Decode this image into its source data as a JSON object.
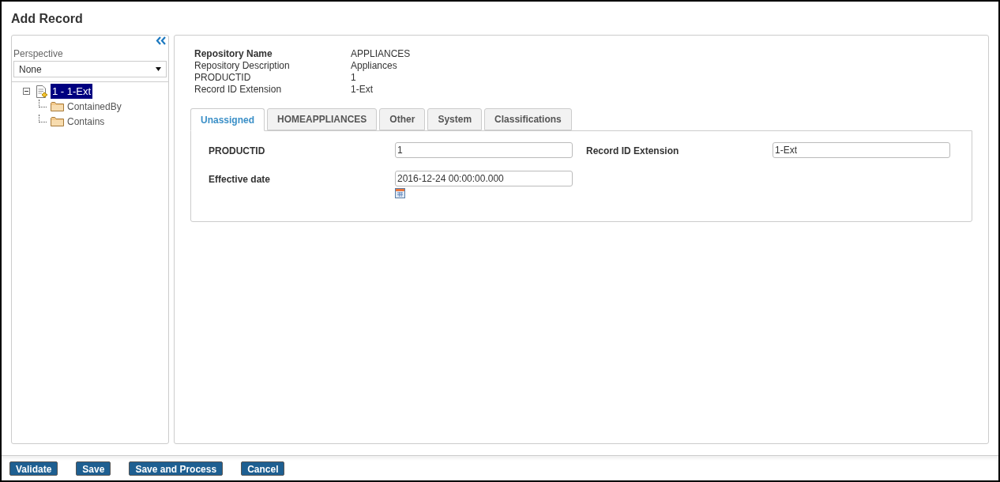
{
  "window": {
    "title": "Add Record"
  },
  "sidebar": {
    "perspective": {
      "label": "Perspective",
      "value": "None"
    },
    "tree": [
      {
        "label": "1 - 1-Ext",
        "selected": true,
        "expanded": true,
        "children": [
          {
            "label": "ContainedBy",
            "selected": false
          },
          {
            "label": "Contains",
            "selected": false
          }
        ]
      }
    ]
  },
  "summary": [
    {
      "label": "Repository Name",
      "value": "APPLIANCES",
      "bold": true
    },
    {
      "label": "Repository Description",
      "value": "Appliances",
      "bold": false
    },
    {
      "label": "PRODUCTID",
      "value": "1",
      "bold": false
    },
    {
      "label": "Record ID Extension",
      "value": "1-Ext",
      "bold": false
    }
  ],
  "tabs": [
    {
      "label": "Unassigned",
      "selected": true
    },
    {
      "label": "HOMEAPPLIANCES",
      "selected": false
    },
    {
      "label": "Other",
      "selected": false
    },
    {
      "label": "System",
      "selected": false
    },
    {
      "label": "Classifications",
      "selected": false
    }
  ],
  "fields": [
    {
      "label": "PRODUCTID",
      "value": "1",
      "calendar": false
    },
    {
      "label": "Record ID Extension",
      "value": "1-Ext",
      "calendar": false
    },
    {
      "label": "Effective date",
      "value": "2016-12-24 00:00:00.000",
      "calendar": true
    }
  ],
  "buttons": [
    "Validate",
    "Save",
    "Save and Process",
    "Cancel"
  ]
}
